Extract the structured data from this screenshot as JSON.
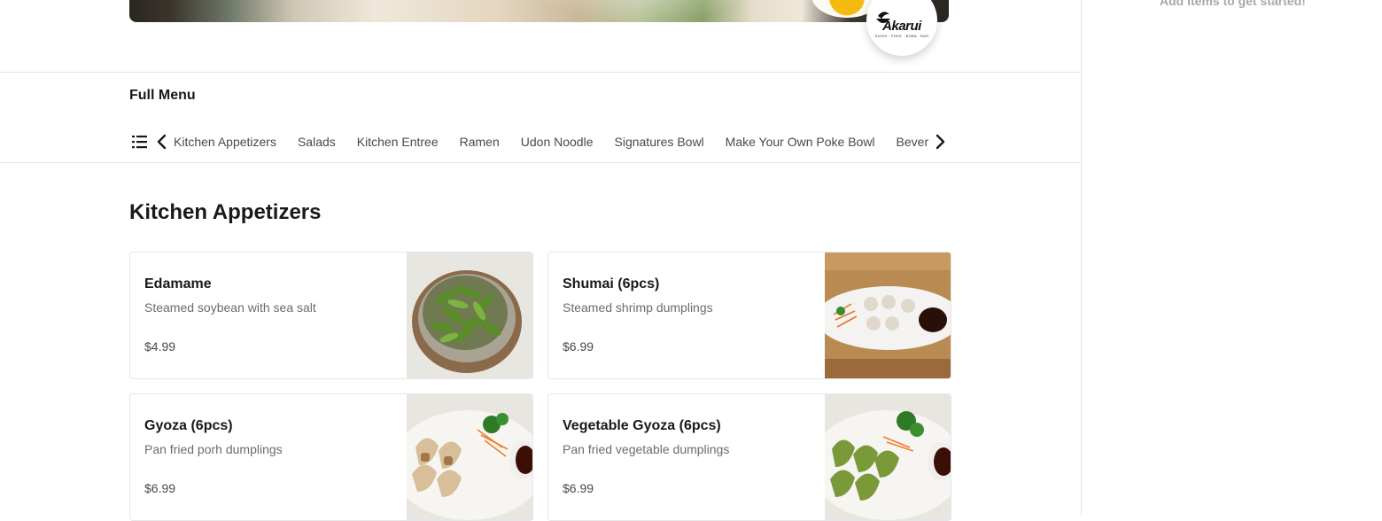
{
  "cart": {
    "empty_message": "Add items to get started!"
  },
  "restaurant": {
    "logo_text": "Akarui",
    "logo_subtext": "SUSHI · POKE · BOBA · BAR"
  },
  "menu": {
    "title": "Full Menu",
    "tabs": [
      "Kitchen Appetizers",
      "Salads",
      "Kitchen Entree",
      "Ramen",
      "Udon Noodle",
      "Signatures Bowl",
      "Make Your Own Poke Bowl",
      "Beverages"
    ]
  },
  "section": {
    "title": "Kitchen Appetizers",
    "items": [
      {
        "name": "Edamame",
        "description": "Steamed soybean with sea salt",
        "price": "$4.99"
      },
      {
        "name": "Shumai (6pcs)",
        "description": "Steamed shrimp dumplings",
        "price": "$6.99"
      },
      {
        "name": "Gyoza (6pcs)",
        "description": "Pan fried porh dumplings",
        "price": "$6.99"
      },
      {
        "name": "Vegetable Gyoza (6pcs)",
        "description": "Pan fried vegetable dumplings",
        "price": "$6.99"
      }
    ]
  },
  "colors": {
    "text": "#191919",
    "muted": "#6b6b6b",
    "border": "#e6e6e6"
  },
  "icons": {
    "list": "list-icon",
    "prev": "chevron-left-icon",
    "next": "chevron-right-icon"
  }
}
